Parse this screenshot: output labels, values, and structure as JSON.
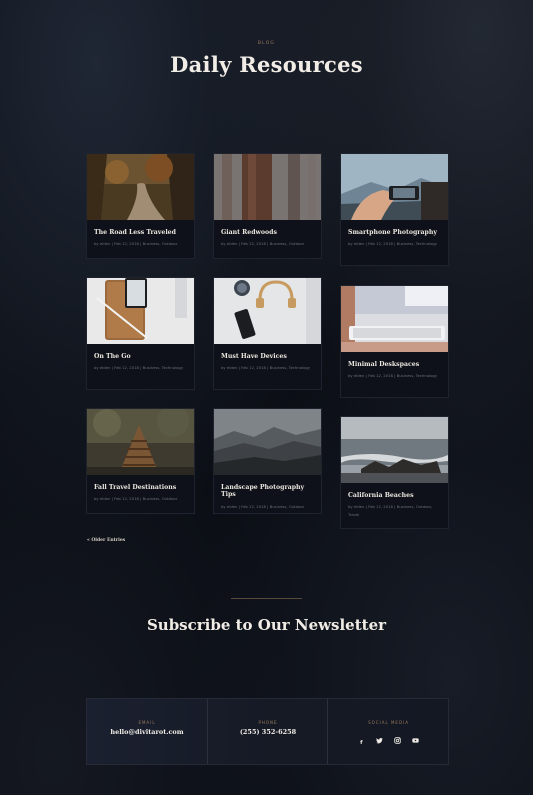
{
  "header": {
    "eyebrow": "BLOG",
    "title": "Daily Resources"
  },
  "posts": [
    {
      "title": "The Road Less Traveled",
      "meta": "by elden | Feb 12, 2018 | Business, Outdoor"
    },
    {
      "title": "Giant Redwoods",
      "meta": "by elden | Feb 12, 2018 | Business, Outdoor"
    },
    {
      "title": "Smartphone Photography",
      "meta": "by elden | Feb 12, 2018 | Business, Technology"
    },
    {
      "title": "On The Go",
      "meta": "by elden | Feb 12, 2018 | Business, Technology"
    },
    {
      "title": "Must Have Devices",
      "meta": "by elden | Feb 12, 2018 | Business, Technology"
    },
    {
      "title": "Minimal Deskspaces",
      "meta": "by elden | Feb 12, 2018 | Business, Technology"
    },
    {
      "title": "Fall Travel Destinations",
      "meta": "by elden | Feb 12, 2018 | Business, Outdoor"
    },
    {
      "title": "Landscape Photography Tips",
      "meta": "by elden | Feb 12, 2018 | Business, Outdoor"
    },
    {
      "title": "California Beaches",
      "meta": "by elden | Feb 12, 2018 | Business, Outdoor, Travel"
    }
  ],
  "pagination": {
    "older_label": "« Older Entries"
  },
  "newsletter": {
    "title": "Subscribe to Our Newsletter"
  },
  "contact": {
    "email_label": "EMAIL",
    "email_value": "hello@divitarot.com",
    "phone_label": "PHONE",
    "phone_value": "(255) 352-6258",
    "social_label": "SOCIAL MEDIA",
    "social_icons": [
      "facebook-icon",
      "twitter-icon",
      "instagram-icon",
      "youtube-icon"
    ]
  },
  "colors": {
    "background": "#0b0e15",
    "accent": "#9a7b5d",
    "card": "#0e1119"
  }
}
